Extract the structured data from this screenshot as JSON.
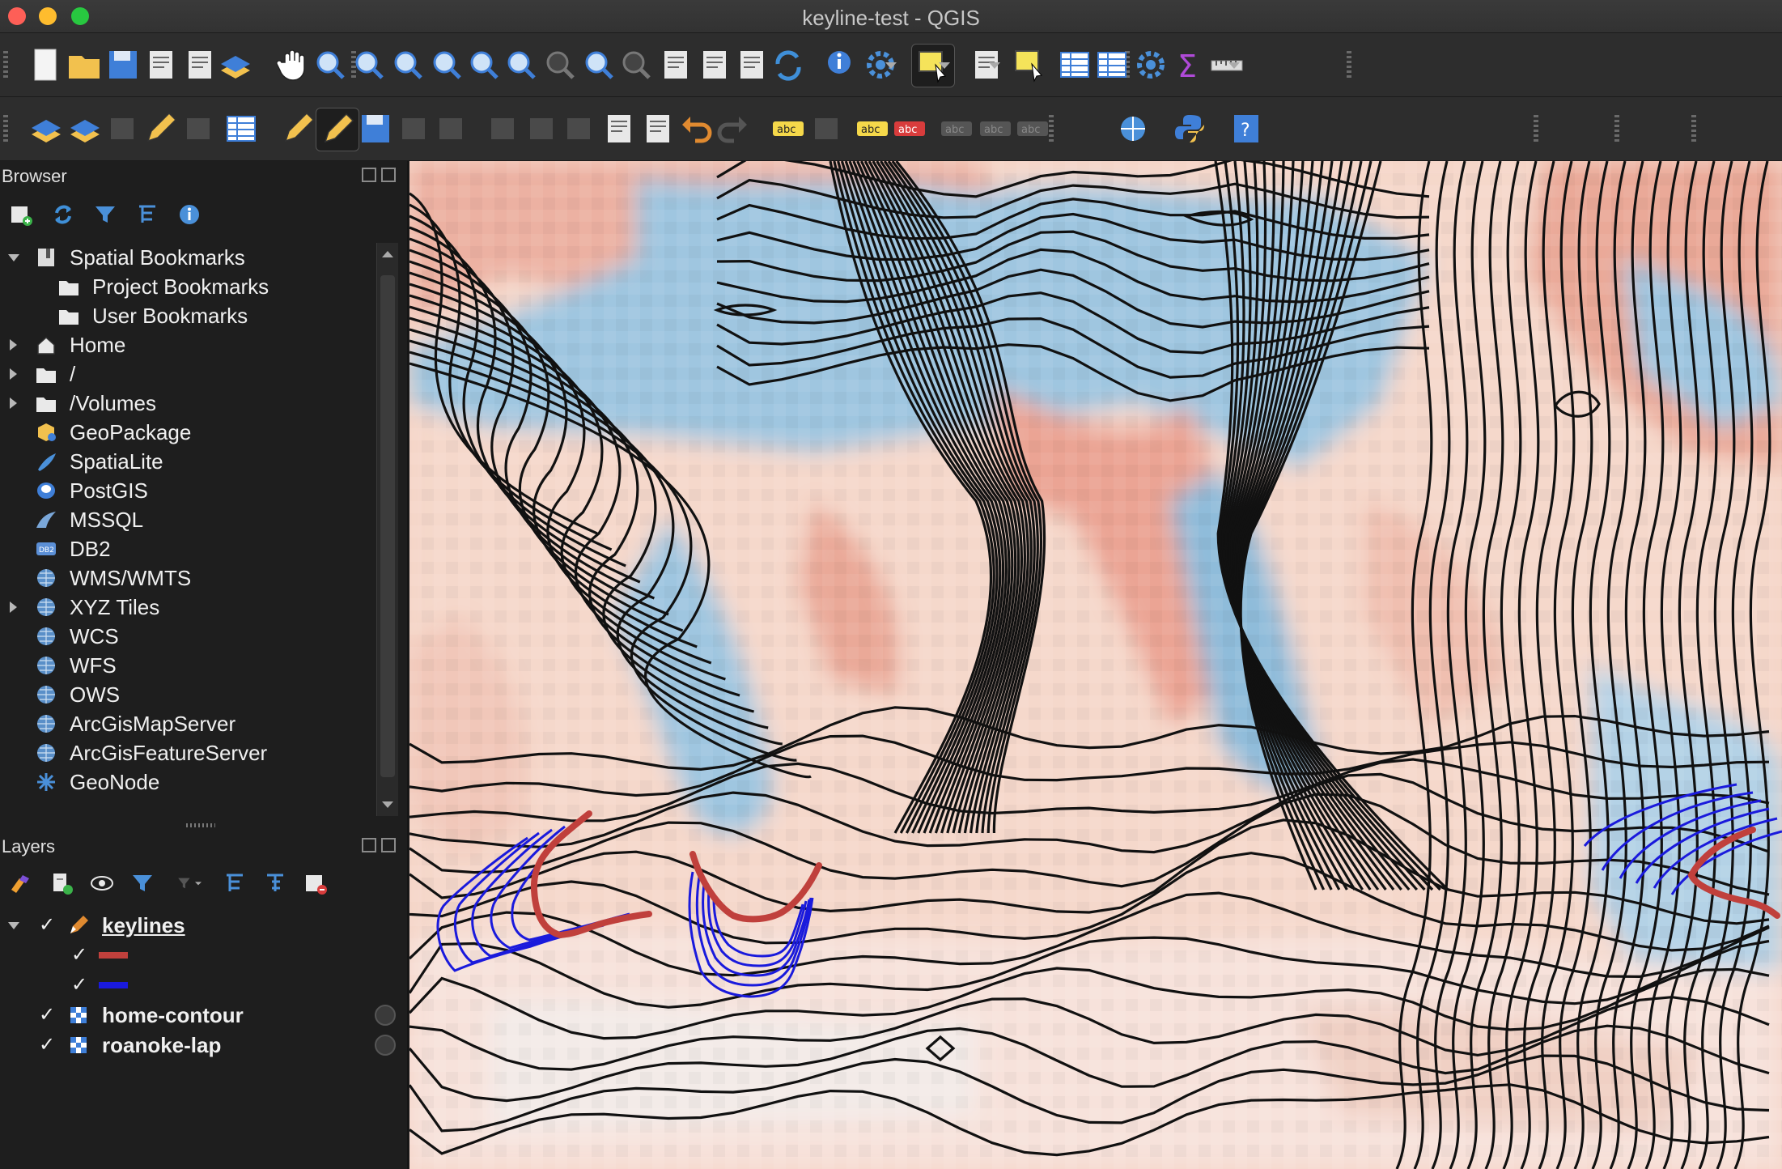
{
  "window": {
    "title": "keyline-test - QGIS"
  },
  "toolbar1": {
    "buttons": [
      "new-project",
      "open-project",
      "save-project",
      "save-as",
      "print-layout",
      "layout-manager",
      "style-manager",
      "pan",
      "pan-to-selection",
      "zoom-in",
      "zoom-out",
      "zoom-full",
      "zoom-to-selection",
      "zoom-to-layer",
      "zoom-native",
      "zoom-last",
      "zoom-next",
      "new-map-view",
      "new-bookmark",
      "show-bookmarks",
      "refresh",
      "identify",
      "run-feature-action",
      "select-features",
      "select-by-value",
      "deselect-all",
      "open-attribute-table",
      "statistics",
      "processing-toolbox",
      "show-statistical-summary",
      "measure"
    ]
  },
  "toolbar2": {
    "buttons": [
      "data-source-manager",
      "new-geopackage-layer",
      "new-temporary-scratch-layer",
      "new-spatialite-layer",
      "new-virtual-layer",
      "digitizing-current-edits",
      "toggle-editing",
      "save-layer-edits",
      "add-feature",
      "vertex-tool",
      "modify-attributes",
      "delete-selected",
      "cut-features",
      "copy-features",
      "paste-features",
      "undo",
      "redo",
      "label-tool",
      "diagram-tool",
      "pin-labels",
      "show-hide-labels",
      "move-label",
      "rotate-label",
      "change-label",
      "metasearch",
      "python-console",
      "help"
    ]
  },
  "browser": {
    "title": "Browser",
    "items": [
      {
        "label": "Spatial Bookmarks",
        "level": 0,
        "expander": "down",
        "icon": "bookmarks-icon"
      },
      {
        "label": "Project Bookmarks",
        "level": 1,
        "expander": "",
        "icon": "folder-icon"
      },
      {
        "label": "User Bookmarks",
        "level": 1,
        "expander": "",
        "icon": "folder-icon"
      },
      {
        "label": "Home",
        "level": 0,
        "expander": "right",
        "icon": "home-icon"
      },
      {
        "label": "/",
        "level": 0,
        "expander": "right",
        "icon": "folder-icon"
      },
      {
        "label": "/Volumes",
        "level": 0,
        "expander": "right",
        "icon": "folder-icon"
      },
      {
        "label": "GeoPackage",
        "level": 0,
        "expander": "",
        "icon": "geopackage-icon"
      },
      {
        "label": "SpatiaLite",
        "level": 0,
        "expander": "",
        "icon": "spatialite-icon"
      },
      {
        "label": "PostGIS",
        "level": 0,
        "expander": "",
        "icon": "postgis-icon"
      },
      {
        "label": "MSSQL",
        "level": 0,
        "expander": "",
        "icon": "mssql-icon"
      },
      {
        "label": "DB2",
        "level": 0,
        "expander": "",
        "icon": "db2-icon"
      },
      {
        "label": "WMS/WMTS",
        "level": 0,
        "expander": "",
        "icon": "globe-icon"
      },
      {
        "label": "XYZ Tiles",
        "level": 0,
        "expander": "right",
        "icon": "globe-icon"
      },
      {
        "label": "WCS",
        "level": 0,
        "expander": "",
        "icon": "globe-icon"
      },
      {
        "label": "WFS",
        "level": 0,
        "expander": "",
        "icon": "globe-icon"
      },
      {
        "label": "OWS",
        "level": 0,
        "expander": "",
        "icon": "globe-icon"
      },
      {
        "label": "ArcGisMapServer",
        "level": 0,
        "expander": "",
        "icon": "globe-icon"
      },
      {
        "label": "ArcGisFeatureServer",
        "level": 0,
        "expander": "",
        "icon": "globe-icon"
      },
      {
        "label": "GeoNode",
        "level": 0,
        "expander": "",
        "icon": "geonode-icon"
      }
    ]
  },
  "layers": {
    "title": "Layers",
    "items": [
      {
        "label": "keylines",
        "kind": "group",
        "checked": true,
        "expander": "down",
        "underline": true
      },
      {
        "label": "",
        "kind": "legend",
        "checked": true,
        "color": "#c0403c"
      },
      {
        "label": "",
        "kind": "legend",
        "checked": true,
        "color": "#1a1adc"
      },
      {
        "label": "home-contour",
        "kind": "raster",
        "checked": true
      },
      {
        "label": "roanoke-lap",
        "kind": "raster",
        "checked": true
      }
    ]
  },
  "colors": {
    "keyline_red": "#c0403c",
    "keyline_blue": "#1a1adc",
    "contour": "#111111",
    "ramp_high": "#e8998a",
    "ramp_low": "#8fbcda"
  }
}
